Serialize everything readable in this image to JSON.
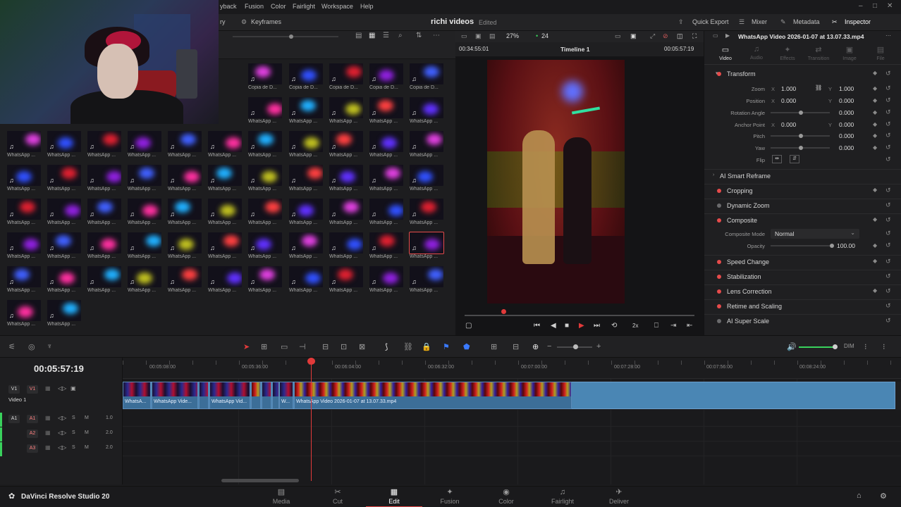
{
  "menu": [
    "yback",
    "Fusion",
    "Color",
    "Fairlight",
    "Workspace",
    "Help"
  ],
  "toolbar": {
    "left_label": "ry",
    "keyframes": "Keyframes",
    "project_title": "richi videos",
    "project_status": "Edited",
    "quick_export": "Quick Export",
    "mixer": "Mixer",
    "metadata": "Metadata",
    "inspector": "Inspector"
  },
  "viewer": {
    "zoom": "27%",
    "fps": "24",
    "src_timecode": "00:34:55:01",
    "timeline_name": "Timeline 1",
    "rec_timecode": "00:05:57:19",
    "speed": "2x"
  },
  "clips": {
    "name_whatsapp": "WhatsApp ...",
    "name_copia": "Copia de D...",
    "name_partial": "a de D..."
  },
  "inspector": {
    "clip_title": "WhatsApp Video 2026-01-07 at 13.07.33.mp4",
    "tabs": [
      "Video",
      "Audio",
      "Effects",
      "Transition",
      "Image",
      "File"
    ],
    "transform": "Transform",
    "params": [
      {
        "label": "Zoom",
        "x": "1.000",
        "y": "1.000"
      },
      {
        "label": "Position",
        "x": "0.000",
        "y": "0.000"
      },
      {
        "label": "Rotation Angle",
        "y": "0.000"
      },
      {
        "label": "Anchor Point",
        "x": "0.000",
        "y": "0.000"
      },
      {
        "label": "Pitch",
        "y": "0.000"
      },
      {
        "label": "Yaw",
        "y": "0.000"
      },
      {
        "label": "Flip"
      }
    ],
    "axis_x": "X",
    "axis_y": "Y",
    "ai_smart_reframe": "AI Smart Reframe",
    "cropping": "Cropping",
    "dynamic_zoom": "Dynamic Zoom",
    "composite": "Composite",
    "composite_mode_label": "Composite Mode",
    "composite_mode_value": "Normal",
    "opacity_label": "Opacity",
    "opacity_value": "100.00",
    "speed_change": "Speed Change",
    "stabilization": "Stabilization",
    "lens_correction": "Lens Correction",
    "retime_scaling": "Retime and Scaling",
    "ai_super_scale": "AI Super Scale"
  },
  "timeline": {
    "timecode": "00:05:57:19",
    "ticks": [
      "00:05:08:00",
      "00:05:36:00",
      "00:06:04:00",
      "00:06:32:00",
      "00:07:00:00",
      "00:07:28:00",
      "00:07:56:00",
      "00:08:24:00"
    ],
    "video_track_name": "Video 1",
    "v1": "V1",
    "a1": "A1",
    "a2": "A2",
    "a3": "A3",
    "s": "S",
    "m": "M",
    "a1_level": "1.0",
    "a2_level": "2.0",
    "a3_level": "2.0",
    "dim": "DIM",
    "clip_labels": [
      "WhatsA...",
      "WhatsApp Vide...",
      "WhatsApp Vid...",
      "W...",
      "WhatsApp Video 2026-01-07 at 13.07.33.mp4"
    ]
  },
  "pages": [
    "Media",
    "Cut",
    "Edit",
    "Fusion",
    "Color",
    "Fairlight",
    "Deliver"
  ],
  "active_page": "Edit",
  "brand": "DaVinci Resolve Studio 20",
  "colors": {
    "accent": "#e24646",
    "clip_blue": "#4a86b4",
    "playhead": "#e23a3a"
  }
}
